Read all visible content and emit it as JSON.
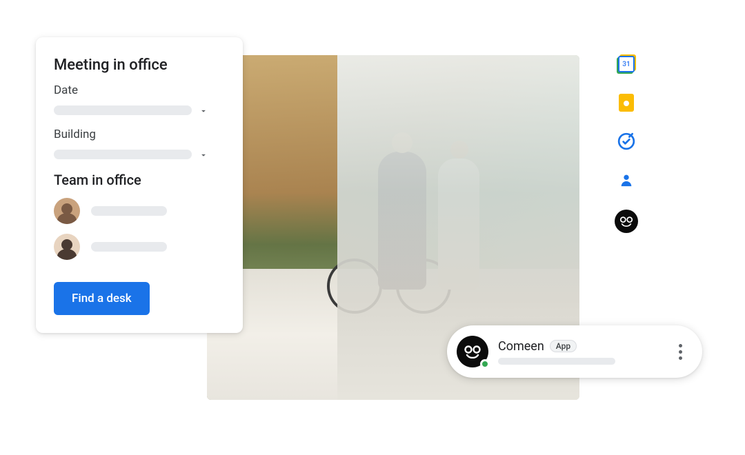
{
  "card": {
    "title": "Meeting in office",
    "date_label": "Date",
    "building_label": "Building",
    "team_heading": "Team in office",
    "cta": "Find a desk"
  },
  "chat": {
    "name": "Comeen",
    "badge": "App"
  },
  "sidepanel": {
    "calendar_day": "31",
    "items": [
      {
        "name": "calendar"
      },
      {
        "name": "keep"
      },
      {
        "name": "tasks"
      },
      {
        "name": "contacts"
      },
      {
        "name": "comeen"
      }
    ]
  },
  "colors": {
    "primary": "#1a73e8",
    "green": "#34a853",
    "yellow": "#fbbc04"
  }
}
